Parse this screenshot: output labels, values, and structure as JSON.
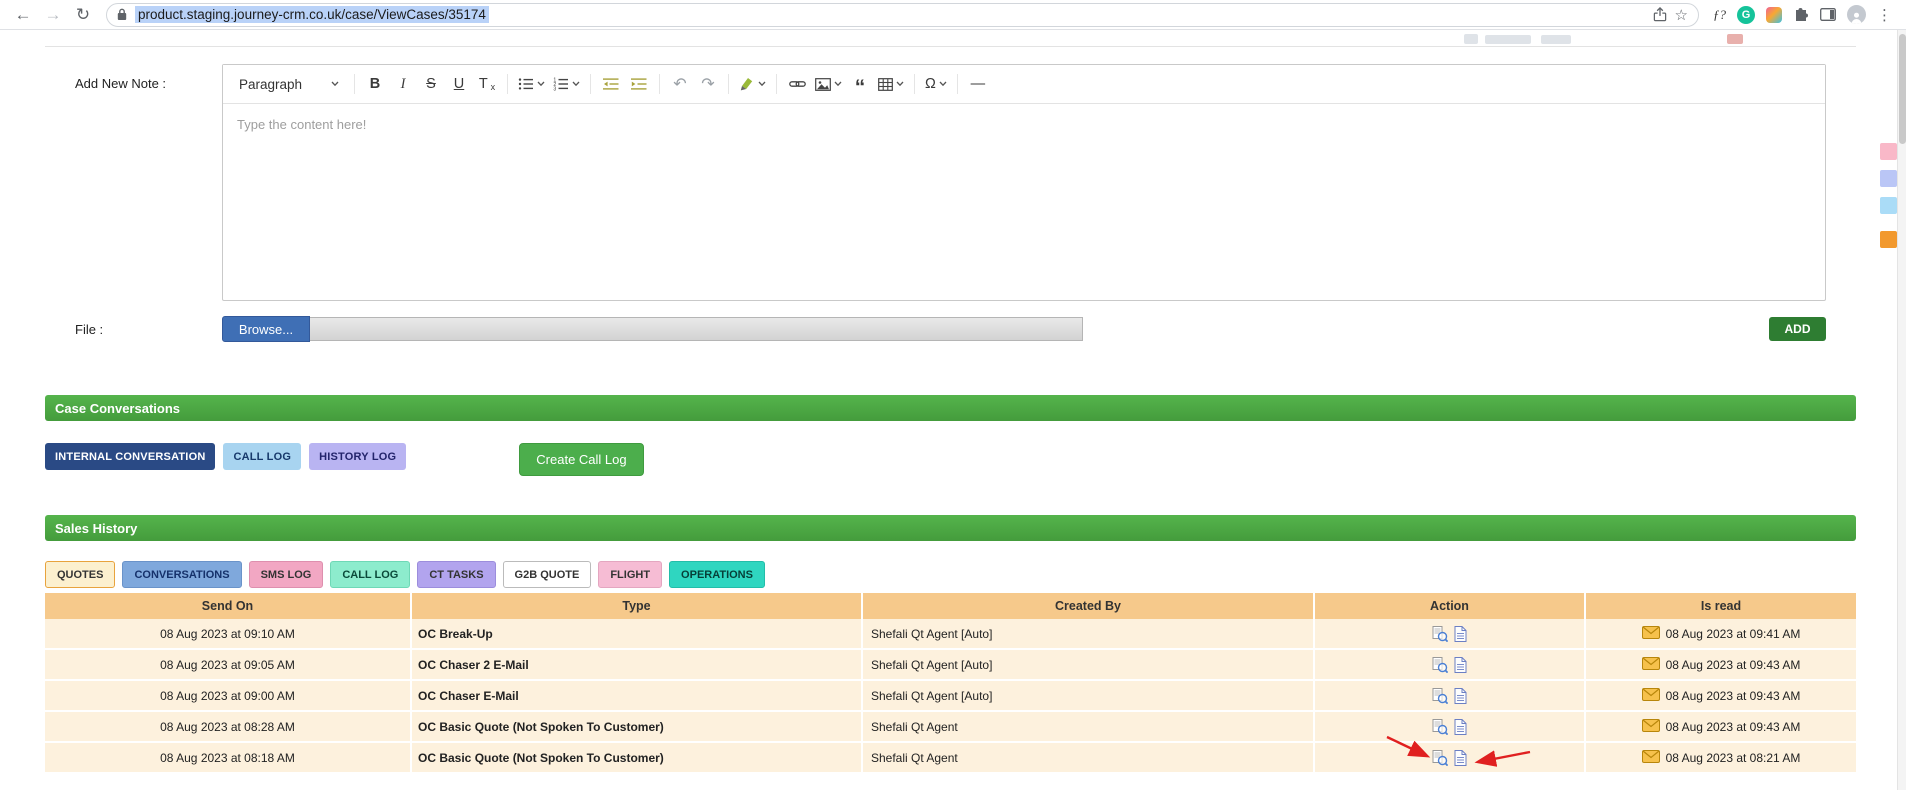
{
  "browser": {
    "url": "product.staging.journey-crm.co.uk/case/ViewCases/35174"
  },
  "icons": {
    "back": "←",
    "forward": "→",
    "refresh": "↻",
    "star": "☆",
    "menu": "⋮",
    "grammarly": "G",
    "fn_extension": "ƒ?",
    "bold": "B",
    "italic": "I",
    "strikethrough": "S",
    "underline": "U",
    "remove_format_t": "T",
    "remove_format_x": "x",
    "undo": "↶",
    "redo": "↷",
    "quote": "“",
    "omega": "Ω",
    "horizontal_rule": "—"
  },
  "note_form": {
    "note_label": "Add New Note :",
    "editor": {
      "paragraph_dropdown": "Paragraph",
      "placeholder": "Type the content here!"
    },
    "file_label": "File :",
    "browse_button": "Browse...",
    "add_button": "ADD"
  },
  "case_conversations": {
    "title": "Case Conversations",
    "buttons": [
      "INTERNAL CONVERSATION",
      "CALL LOG",
      "HISTORY LOG"
    ],
    "create_call_log_button": "Create Call Log"
  },
  "sales_history": {
    "title": "Sales History",
    "tabs": [
      "QUOTES",
      "CONVERSATIONS",
      "SMS LOG",
      "CALL LOG",
      "CT TASKS",
      "G2B QUOTE",
      "FLIGHT",
      "OPERATIONS"
    ],
    "table": {
      "headers": [
        "Send On",
        "Type",
        "Created By",
        "Action",
        "Is read"
      ],
      "rows": [
        {
          "send_on": "08 Aug 2023 at 09:10 AM",
          "type": "OC Break-Up",
          "created_by": "Shefali Qt Agent [Auto]",
          "is_read": "08 Aug 2023 at 09:41 AM"
        },
        {
          "send_on": "08 Aug 2023 at 09:05 AM",
          "type": "OC Chaser 2 E-Mail",
          "created_by": "Shefali Qt Agent [Auto]",
          "is_read": "08 Aug 2023 at 09:43 AM"
        },
        {
          "send_on": "08 Aug 2023 at 09:00 AM",
          "type": "OC Chaser E-Mail",
          "created_by": "Shefali Qt Agent [Auto]",
          "is_read": "08 Aug 2023 at 09:43 AM"
        },
        {
          "send_on": "08 Aug 2023 at 08:28 AM",
          "type": "OC Basic Quote (Not Spoken To Customer)",
          "created_by": "Shefali Qt Agent",
          "is_read": "08 Aug 2023 at 09:43 AM"
        },
        {
          "send_on": "08 Aug 2023 at 08:18 AM",
          "type": "OC Basic Quote (Not Spoken To Customer)",
          "created_by": "Shefali Qt Agent",
          "is_read": "08 Aug 2023 at 08:21 AM"
        }
      ]
    }
  },
  "colors": {
    "section_header_green": "#4cae4c",
    "table_header_orange": "#f6c98b",
    "table_row_cream": "#fdf1dd",
    "add_button_green": "#2e7d32",
    "browse_button_blue": "#3f6fb5",
    "internal_conversation_navy": "#2a4a85",
    "call_log_light_blue": "#a8d4f0",
    "history_log_lavender": "#b9b4f2",
    "tab_quotes": "#fcf0cf",
    "tab_conversations": "#7fa8dc",
    "tab_sms_log": "#f2a7c3",
    "tab_call_log": "#8deccd",
    "tab_ct_tasks": "#b2a4ee",
    "tab_g2b_quote": "#ffffff",
    "tab_flight": "#f6bcd4",
    "tab_operations": "#2fd6c0",
    "annotation_arrow_red": "#e02020",
    "grammarly_green": "#15c39a",
    "url_selection_blue": "#b9d2f8"
  }
}
